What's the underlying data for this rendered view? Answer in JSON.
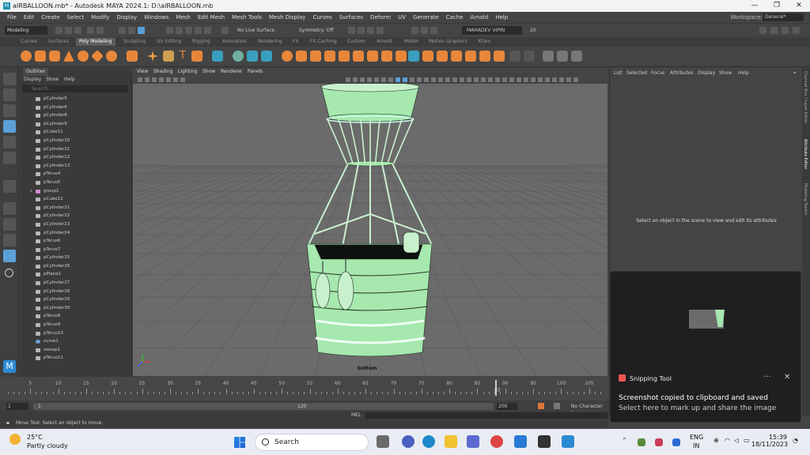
{
  "titlebar": {
    "title": "aIRBALLOON.mb* - Autodesk MAYA 2024.1: D:\\aIRBALLOON.mb",
    "minimize": "—",
    "maximize": "❐",
    "close": "✕"
  },
  "menubar": {
    "items": [
      "File",
      "Edit",
      "Create",
      "Select",
      "Modify",
      "Display",
      "Windows",
      "Mesh",
      "Edit Mesh",
      "Mesh Tools",
      "Mesh Display",
      "Curves",
      "Surfaces",
      "Deform",
      "UV",
      "Generate",
      "Cache",
      "Arnold",
      "Help"
    ],
    "workspace_label": "Workspace:",
    "workspace_value": "General*"
  },
  "statusline": {
    "mode": "Modeling",
    "live_surface": "No Live Surface",
    "symmetry": "Symmetry: Off",
    "user": "MAHADEV VIPIN",
    "user_count": "20"
  },
  "shelf_tabs": {
    "items": [
      "Curves",
      "Surfaces",
      "Poly Modeling",
      "Sculpting",
      "UV Editing",
      "Rigging",
      "Animation",
      "Rendering",
      "FX",
      "FX Caching",
      "Custom",
      "Arnold",
      "MASH",
      "Motion Graphics",
      "XGen"
    ],
    "active": "Poly Modeling"
  },
  "outliner": {
    "tab": "Outliner",
    "menu": [
      "Display",
      "Show",
      "Help"
    ],
    "search_placeholder": "Search...",
    "items": [
      {
        "label": "pCylinder5",
        "type": "mesh"
      },
      {
        "label": "pCylinder6",
        "type": "mesh"
      },
      {
        "label": "pCylinder8",
        "type": "mesh"
      },
      {
        "label": "pCylinder9",
        "type": "mesh"
      },
      {
        "label": "pCube11",
        "type": "mesh"
      },
      {
        "label": "pCylinder10",
        "type": "mesh"
      },
      {
        "label": "pCylinder11",
        "type": "mesh"
      },
      {
        "label": "pCylinder12",
        "type": "mesh"
      },
      {
        "label": "pCylinder13",
        "type": "mesh"
      },
      {
        "label": "pTorus4",
        "type": "mesh"
      },
      {
        "label": "pTorus5",
        "type": "mesh"
      },
      {
        "label": "group1",
        "type": "group"
      },
      {
        "label": "pCube12",
        "type": "mesh"
      },
      {
        "label": "pCylinder21",
        "type": "mesh"
      },
      {
        "label": "pCylinder22",
        "type": "mesh"
      },
      {
        "label": "pCylinder23",
        "type": "mesh"
      },
      {
        "label": "pCylinder24",
        "type": "mesh"
      },
      {
        "label": "pTorus6",
        "type": "mesh"
      },
      {
        "label": "pTorus7",
        "type": "mesh"
      },
      {
        "label": "pCylinder25",
        "type": "mesh"
      },
      {
        "label": "pCylinder26",
        "type": "mesh"
      },
      {
        "label": "pPlane1",
        "type": "mesh"
      },
      {
        "label": "pCylinder27",
        "type": "mesh"
      },
      {
        "label": "pCylinder28",
        "type": "mesh"
      },
      {
        "label": "pCylinder29",
        "type": "mesh"
      },
      {
        "label": "pCylinder30",
        "type": "mesh"
      },
      {
        "label": "pTorus8",
        "type": "mesh"
      },
      {
        "label": "pTorus9",
        "type": "mesh"
      },
      {
        "label": "pTorus10",
        "type": "mesh"
      },
      {
        "label": "curve1",
        "type": "curve"
      },
      {
        "label": "sweep1",
        "type": "mesh"
      },
      {
        "label": "pTorus11",
        "type": "mesh"
      }
    ]
  },
  "viewport": {
    "menu": [
      "View",
      "Shading",
      "Lighting",
      "Show",
      "Renderer",
      "Panels"
    ],
    "camera_label": "bottom",
    "model_color": "#a6e8ae",
    "background": "#6b6b6b"
  },
  "attribute_editor": {
    "menu": [
      "List",
      "Selected",
      "Focus",
      "Attributes",
      "Display",
      "Show",
      "Help"
    ],
    "message": "Select an object in the scene to view and edit its attributes",
    "side_tabs": [
      "Channel Box / Layer Editor",
      "Attribute Editor",
      "Modeling Toolkit"
    ],
    "active_side_tab": "Attribute Editor"
  },
  "timeline": {
    "ticks": [
      "5",
      "10",
      "15",
      "20",
      "25",
      "30",
      "35",
      "40",
      "45",
      "50",
      "55",
      "60",
      "65",
      "70",
      "75",
      "80",
      "85",
      "90",
      "95",
      "100",
      "105"
    ],
    "current_frame": "87",
    "range_start": "1",
    "range_start_inner": "1",
    "range_end_inner": "120",
    "range_end": "200",
    "character_set": "No Character Set"
  },
  "cmdline": {
    "label": "MEL"
  },
  "helpline": {
    "text": "Move Tool: Select an object to move."
  },
  "toast": {
    "app": "Snipping Tool",
    "more": "···",
    "close": "✕",
    "line1": "Screenshot copied to clipboard and saved",
    "line2": "Select here to mark up and share the image"
  },
  "taskbar": {
    "temperature": "25°C",
    "condition": "Partly cloudy",
    "search_label": "Search",
    "language_1": "ENG",
    "language_2": "IN",
    "time": "15:39",
    "date": "18/11/2023"
  }
}
